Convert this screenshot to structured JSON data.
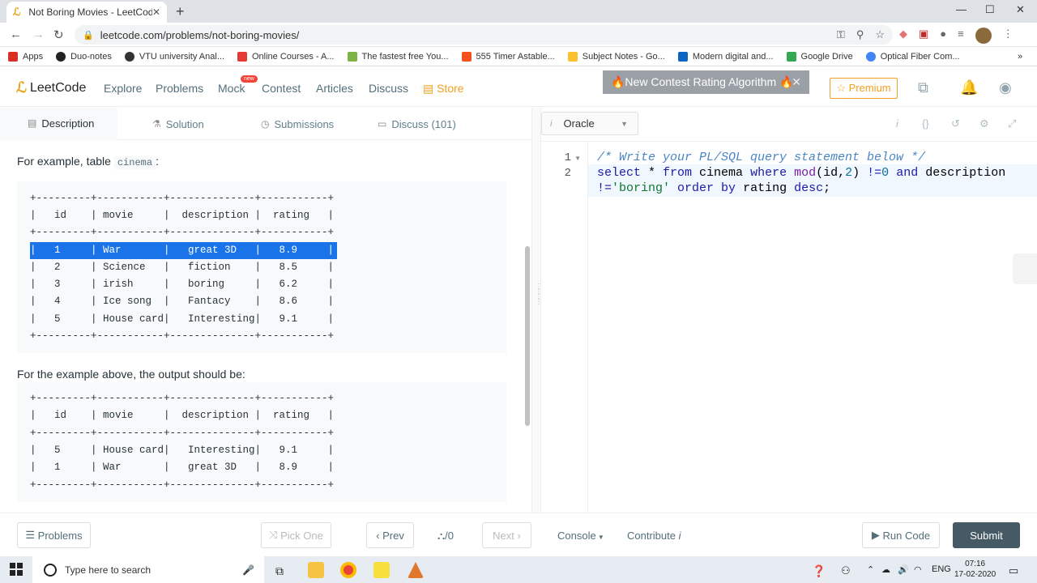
{
  "browser": {
    "tab_title": "Not Boring Movies - LeetCode",
    "tab_close": "✕",
    "new_tab": "+",
    "url": "leetcode.com/problems/not-boring-movies/",
    "bookmarks": [
      {
        "label": "Apps",
        "color": "#d93025"
      },
      {
        "label": "Duo-notes",
        "color": "#222"
      },
      {
        "label": "VTU university Anal...",
        "color": "#333"
      },
      {
        "label": "Online Courses - A...",
        "color": "#e53935"
      },
      {
        "label": "The fastest free You...",
        "color": "#7cb342"
      },
      {
        "label": "555 Timer Astable...",
        "color": "#f4511e"
      },
      {
        "label": "Subject Notes - Go...",
        "color": "#fbc02d"
      },
      {
        "label": "Modern digital and...",
        "color": "#0a66c2"
      },
      {
        "label": "Google Drive",
        "color": "#34a853"
      },
      {
        "label": "Optical Fiber Com...",
        "color": "#4285f4"
      }
    ],
    "more": "»"
  },
  "nav": {
    "logo": "LeetCode",
    "links": {
      "explore": "Explore",
      "problems": "Problems",
      "mock": "Mock",
      "contest": "Contest",
      "articles": "Articles",
      "discuss": "Discuss",
      "store": "Store"
    },
    "mock_badge": "new",
    "banner": "🔥New Contest Rating Algorithm 🔥",
    "banner_close": "✕",
    "premium": "☆ Premium"
  },
  "left_tabs": {
    "description": "Description",
    "solution": "Solution",
    "submissions": "Submissions",
    "discuss": "Discuss (101)"
  },
  "description": {
    "example_intro": "For example, table",
    "table_name": "cinema",
    "colon": ":",
    "table_lines": [
      "+---------+-----------+--------------+-----------+",
      "|   id    | movie     |  description |  rating   |",
      "+---------+-----------+--------------+-----------+",
      "|   1     | War       |   great 3D   |   8.9     |",
      "|   2     | Science   |   fiction    |   8.5     |",
      "|   3     | irish     |   boring     |   6.2     |",
      "|   4     | Ice song  |   Fantacy    |   8.6     |",
      "|   5     | House card|   Interesting|   9.1     |",
      "+---------+-----------+--------------+-----------+"
    ],
    "output_intro": "For the example above, the output should be:",
    "output_lines": [
      "+---------+-----------+--------------+-----------+",
      "|   id    | movie     |  description |  rating   |",
      "+---------+-----------+--------------+-----------+",
      "|   5     | House card|   Interesting|   9.1     |",
      "|   1     | War       |   great 3D   |   8.9     |",
      "+---------+-----------+--------------+-----------+"
    ]
  },
  "editor": {
    "language": "Oracle",
    "line_numbers": [
      "1",
      "2"
    ],
    "line1": "/* Write your PL/SQL query statement below */"
  },
  "bottom": {
    "problems": "Problems",
    "pick_one": "Pick One",
    "prev": "Prev",
    "counter": "/0",
    "next": "Next",
    "console": "Console",
    "contribute": "Contribute",
    "run_code": "Run Code",
    "submit": "Submit"
  },
  "taskbar": {
    "search_placeholder": "Type here to search",
    "lang": "ENG",
    "time": "07:16",
    "date": "17-02-2020"
  },
  "colors": {
    "accent": "#f0a020",
    "submit_bg": "#455a64",
    "selection": "#1a73e8"
  }
}
